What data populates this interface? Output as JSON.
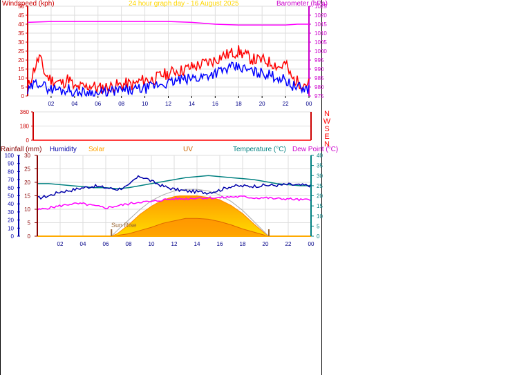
{
  "colors": {
    "windspeed": "#ff0000",
    "gust": "#ff0000",
    "avg_wind": "#0000ff",
    "barometer": "#ff00ff",
    "title": "#ffd700",
    "direction": "#ff0000",
    "rainfall_axis": "#880000",
    "humidity": "#0000aa",
    "solar": "#ffa500",
    "uv": "#cc4400",
    "temperature": "#008080",
    "dewpoint": "#ff00ff",
    "grid": "#dddddd",
    "sun_rise": "#996633"
  },
  "chart_data": [
    {
      "type": "line",
      "title": "24 hour graph day - 16 August 2025",
      "ylabel": "Windspeed (kph)",
      "y2label": "Barometer (hPa)",
      "x_ticks": [
        "02",
        "04",
        "06",
        "08",
        "10",
        "12",
        "14",
        "16",
        "18",
        "20",
        "22",
        "00"
      ],
      "xlim": [
        0,
        24
      ],
      "ylim": [
        0,
        50
      ],
      "y_ticks": [
        "0",
        "5",
        "10",
        "15",
        "20",
        "25",
        "30",
        "35",
        "40",
        "45",
        "50"
      ],
      "y2lim": [
        975,
        1025
      ],
      "y2_ticks": [
        "975",
        "980",
        "985",
        "990",
        "995",
        "1000",
        "1005",
        "1010",
        "1015",
        "1020",
        "1025"
      ],
      "grid": true,
      "series": [
        {
          "kind": "gust",
          "x": [
            0,
            0.5,
            1.0,
            1.5,
            2.0,
            2.5,
            3.0,
            3.5,
            4.0,
            4.5,
            5.0,
            5.5,
            6.0,
            6.5,
            7.0,
            7.5,
            8.0,
            8.5,
            9.0,
            9.5,
            10.0,
            10.5,
            11.0,
            11.5,
            12.0,
            12.5,
            13.0,
            13.5,
            14.0,
            14.5,
            15.0,
            15.5,
            16.0,
            16.5,
            17.0,
            17.5,
            18.0,
            18.5,
            19.0,
            19.5,
            20.0,
            20.5,
            21.0,
            21.5,
            22.0,
            22.5,
            23.0,
            23.5,
            24.0
          ],
          "y": [
            4,
            14,
            22,
            12,
            9,
            8,
            7,
            10,
            4,
            5,
            5,
            6,
            4,
            5,
            5,
            6,
            6,
            7,
            6,
            8,
            9,
            9,
            10,
            12,
            12,
            14,
            14,
            15,
            16,
            17,
            18,
            19,
            20,
            22,
            23,
            24,
            25,
            23,
            21,
            20,
            20,
            19,
            18,
            16,
            18,
            10,
            8,
            7,
            7
          ]
        },
        {
          "kind": "average",
          "x": [
            0,
            0.5,
            1.0,
            1.5,
            2.0,
            2.5,
            3.0,
            3.5,
            4.0,
            4.5,
            5.0,
            5.5,
            6.0,
            6.5,
            7.0,
            7.5,
            8.0,
            8.5,
            9.0,
            9.5,
            10.0,
            10.5,
            11.0,
            11.5,
            12.0,
            12.5,
            13.0,
            13.5,
            14.0,
            14.5,
            15.0,
            15.5,
            16.0,
            16.5,
            17.0,
            17.5,
            18.0,
            18.5,
            19.0,
            19.5,
            20.0,
            20.5,
            21.0,
            21.5,
            22.0,
            22.5,
            23.0,
            23.5,
            24.0
          ],
          "y": [
            2,
            6,
            8,
            5,
            4,
            4,
            3,
            4,
            1,
            2,
            2,
            2,
            1,
            2,
            2,
            3,
            3,
            3,
            3,
            4,
            4,
            5,
            6,
            7,
            7,
            8,
            9,
            9,
            10,
            10,
            11,
            12,
            13,
            14,
            15,
            16,
            16,
            15,
            14,
            13,
            13,
            12,
            11,
            10,
            9,
            6,
            5,
            4,
            4
          ]
        },
        {
          "kind": "barometer",
          "x": [
            0,
            2,
            4,
            6,
            8,
            10,
            12,
            14,
            16,
            18,
            19,
            20,
            21,
            22,
            23,
            24
          ],
          "y": [
            1016,
            1016.5,
            1016.5,
            1016.5,
            1016.5,
            1016.5,
            1016.5,
            1016,
            1015,
            1014.5,
            1014.5,
            1014.5,
            1014.5,
            1014.5,
            1015,
            1015
          ]
        }
      ]
    },
    {
      "type": "scatter",
      "title": "",
      "ylabel": "",
      "y_ticks": [
        "0",
        "180",
        "360"
      ],
      "ylim": [
        0,
        360
      ],
      "direction_labels": [
        "N",
        "W",
        "S",
        "E",
        "N"
      ],
      "xlim": [
        0,
        24
      ],
      "grid": true,
      "series": [
        {
          "kind": "direction",
          "x": [
            0,
            24
          ],
          "y": [
            0,
            0
          ]
        }
      ]
    },
    {
      "type": "area",
      "title": "",
      "xlim": [
        0,
        24
      ],
      "x_ticks": [
        "02",
        "04",
        "06",
        "08",
        "10",
        "12",
        "14",
        "16",
        "18",
        "20",
        "22",
        "00"
      ],
      "axes_labels": {
        "rainfall": "Rainfall (mm)",
        "humidity": "Humidity",
        "solar": "Solar",
        "uv": "UV",
        "temperature": "Temperature (°C)",
        "dewpoint": "Dew Point (°C)"
      },
      "rain_ticks": [
        "0",
        "5",
        "10",
        "15",
        "20",
        "25",
        "30"
      ],
      "rain_lim": [
        0,
        30
      ],
      "humidity_ticks": [
        "0",
        "10",
        "20",
        "30",
        "40",
        "50",
        "60",
        "70",
        "80",
        "90",
        "100"
      ],
      "humidity_lim": [
        0,
        100
      ],
      "temp_ticks": [
        "0",
        "5",
        "10",
        "15",
        "20",
        "25",
        "30",
        "35",
        "40"
      ],
      "temp_lim": [
        0,
        40
      ],
      "annotations": [
        "Sun Rise"
      ],
      "sunrise_hour": 6.5,
      "sunset_hour": 20.3,
      "grid": true,
      "series": [
        {
          "kind": "humidity",
          "x": [
            0,
            1,
            2,
            3,
            4,
            5,
            6,
            7,
            8,
            8.5,
            9,
            9.5,
            10,
            11,
            12,
            13,
            14,
            15,
            16,
            17,
            18,
            19,
            20,
            21,
            22,
            23,
            24
          ],
          "y": [
            47,
            50,
            55,
            57,
            60,
            62,
            60,
            58,
            62,
            70,
            74,
            72,
            68,
            62,
            58,
            56,
            55,
            54,
            57,
            62,
            62,
            62,
            63,
            63,
            64,
            63,
            63
          ]
        },
        {
          "kind": "temperature",
          "x": [
            0,
            1,
            2,
            3,
            4,
            5,
            6,
            7,
            8,
            9,
            10,
            11,
            12,
            13,
            14,
            15,
            16,
            17,
            18,
            19,
            20,
            21,
            22,
            23,
            24
          ],
          "y": [
            26,
            26,
            25.5,
            25,
            24.5,
            24,
            24,
            23.5,
            24,
            25,
            26,
            27,
            28,
            29,
            29.5,
            30,
            29.5,
            29,
            28.5,
            28,
            27,
            26,
            25.5,
            25,
            25
          ]
        },
        {
          "kind": "dewpoint",
          "x": [
            0,
            1,
            2,
            3,
            4,
            5,
            6,
            7,
            8,
            9,
            10,
            11,
            12,
            13,
            14,
            15,
            16,
            17,
            18,
            19,
            20,
            21,
            22,
            23,
            24
          ],
          "y": [
            13,
            14,
            15,
            16,
            16,
            15,
            14,
            15,
            16,
            17,
            17,
            18,
            18.5,
            18.5,
            19,
            19,
            19,
            19.5,
            19.5,
            19,
            19,
            18.5,
            18.5,
            18,
            18
          ]
        },
        {
          "kind": "solar",
          "x": [
            6.5,
            7,
            8,
            9,
            10,
            10.5,
            11,
            11.5,
            12,
            12.5,
            13,
            13.5,
            14,
            14.5,
            15,
            15.5,
            16,
            17,
            18,
            19,
            20,
            20.3
          ],
          "y": [
            0,
            3,
            14,
            27,
            37,
            41,
            44,
            47,
            49,
            50,
            50,
            50,
            50,
            49,
            48,
            47,
            45,
            38,
            28,
            15,
            3,
            0
          ]
        },
        {
          "kind": "uv",
          "x": [
            6.5,
            8,
            9,
            10,
            11,
            12,
            13,
            14,
            15,
            16,
            17,
            18,
            19,
            20,
            20.3
          ],
          "y": [
            0,
            3,
            7,
            11,
            16,
            19,
            22,
            22,
            21,
            18,
            14,
            9,
            5,
            1,
            0
          ]
        },
        {
          "kind": "solar_max",
          "x": [
            6.5,
            7,
            8,
            9,
            10,
            11,
            12,
            13,
            14,
            15,
            16,
            17,
            18,
            19,
            20,
            20.3
          ],
          "y": [
            0,
            7,
            20,
            33,
            44,
            51,
            56,
            58,
            58,
            56,
            51,
            43,
            32,
            18,
            4,
            0
          ]
        }
      ]
    }
  ]
}
